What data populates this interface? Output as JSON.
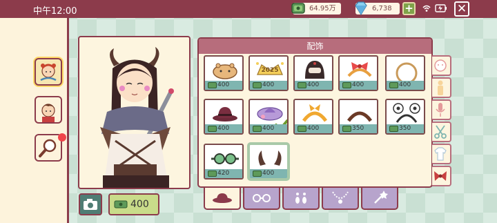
{
  "status_bar": {
    "time": "中午12:00"
  },
  "currency": {
    "money": "64.95万",
    "gems": "6,738",
    "add": "+"
  },
  "close_label": "✕",
  "shop": {
    "title": "配饰",
    "items": [
      {
        "name": "capybara-hat",
        "price": "400"
      },
      {
        "name": "2025-crown",
        "price": "400"
      },
      {
        "name": "helmet",
        "price": "400"
      },
      {
        "name": "bow-headband",
        "price": "400"
      },
      {
        "name": "ring-halo",
        "price": "400"
      },
      {
        "name": "bowler-hat",
        "price": "400"
      },
      {
        "name": "purple-bonnet",
        "price": "400",
        "equipped": true
      },
      {
        "name": "orange-headband",
        "price": "400"
      },
      {
        "name": "brown-headband",
        "price": "350"
      },
      {
        "name": "soccer-ear-headband",
        "price": "350"
      },
      {
        "name": "goggles",
        "price": "420"
      },
      {
        "name": "horns",
        "price": "400",
        "selected": true
      }
    ]
  },
  "character_price": "400",
  "colors": {
    "accent": "#8c3b4b",
    "tab_active": "#fdf5df",
    "tab_inactive": "#b7a4cc",
    "price_strip": "#7fb5b0"
  }
}
